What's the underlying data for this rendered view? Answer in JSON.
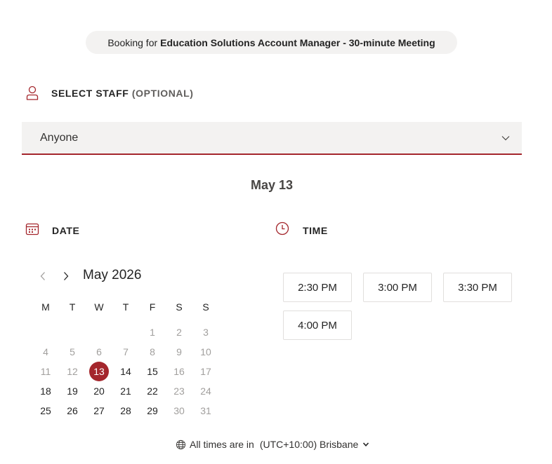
{
  "header": {
    "booking_prefix": "Booking for",
    "booking_service": "Education Solutions Account Manager - 30-minute Meeting"
  },
  "staff": {
    "label": "SELECT STAFF",
    "optional_label": "(OPTIONAL)",
    "selected_value": "Anyone",
    "icon": "person-icon"
  },
  "selected_date_heading": "May 13",
  "date_section": {
    "label": "DATE",
    "icon": "calendar-icon"
  },
  "time_section": {
    "label": "TIME",
    "icon": "clock-icon"
  },
  "calendar": {
    "month_label": "May 2026",
    "weekdays": [
      "M",
      "T",
      "W",
      "T",
      "F",
      "S",
      "S"
    ],
    "weeks": [
      [
        "",
        "",
        "",
        "",
        "1",
        "2",
        "3"
      ],
      [
        "4",
        "5",
        "6",
        "7",
        "8",
        "9",
        "10"
      ],
      [
        "11",
        "12",
        "13",
        "14",
        "15",
        "16",
        "17"
      ],
      [
        "18",
        "19",
        "20",
        "21",
        "22",
        "23",
        "24"
      ],
      [
        "25",
        "26",
        "27",
        "28",
        "29",
        "30",
        "31"
      ]
    ],
    "available_days": [
      "13",
      "14",
      "15",
      "18",
      "19",
      "20",
      "21",
      "22",
      "25",
      "26",
      "27",
      "28",
      "29"
    ],
    "selected_day": "13"
  },
  "time_slots": [
    "2:30 PM",
    "3:00 PM",
    "3:30 PM",
    "4:00 PM"
  ],
  "timezone": {
    "prefix": "All times are in",
    "value": "(UTC+10:00) Brisbane"
  },
  "colors": {
    "accent": "#a4262c",
    "field_background": "#f3f2f1",
    "disabled_text": "#a19f9d"
  }
}
